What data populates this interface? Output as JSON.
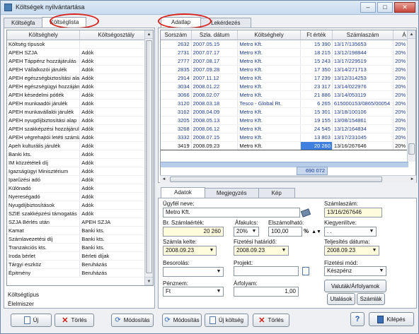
{
  "window": {
    "title": "Költségek nyilvántartása",
    "btn_min": "–",
    "btn_max": "□",
    "btn_close": "✕"
  },
  "left_tabs": [
    {
      "label": "Költségfa"
    },
    {
      "label": "Költséglista"
    }
  ],
  "left_grid": {
    "headers": [
      "Költséghely",
      "Költségosztály"
    ],
    "rows": [
      [
        "Költség típusok",
        ""
      ],
      [
        "APEH SZJA",
        "Adók"
      ],
      [
        "APEH Táppénz hozzájárulás",
        "Adók"
      ],
      [
        "APEH Vállalkozói járulék",
        "Adók"
      ],
      [
        "APEH egészségbiztosítási alap",
        "Adók"
      ],
      [
        "APEH egészségügyi hozzájárulás",
        "Adók"
      ],
      [
        "APEH késedelmi pótlék",
        "Adók"
      ],
      [
        "APEH munkaadói járulék",
        "Adók"
      ],
      [
        "APEH munkavállalói járulék",
        "Adók"
      ],
      [
        "APEH nyugdíjbiztosítási alap",
        "Adók"
      ],
      [
        "APEH szakképzési hozzájárulás",
        "Adók"
      ],
      [
        "APEH végrehajtói letéti számla",
        "Adók"
      ],
      [
        "Apeh kulturális járulék",
        "Adók"
      ],
      [
        "Banki kts.",
        "Adók"
      ],
      [
        "IM közzétételi díj",
        "Adók"
      ],
      [
        "Igazságügyi Minisztérium",
        "Adók"
      ],
      [
        "Iparűzési adó",
        "Adók"
      ],
      [
        "Különadó",
        "Adók"
      ],
      [
        "Nyereségadó",
        "Adók"
      ],
      [
        "Nyugdíjbiztosítások",
        "Adók"
      ],
      [
        "SZIE szakképzési támogatás",
        "Adók"
      ],
      [
        "SZJA Bérlés után",
        "APEH SZJA"
      ],
      [
        "Kamat",
        "Banki kts."
      ],
      [
        "Számlavezetési díj",
        "Banki kts."
      ],
      [
        "Tranzakciós kts.",
        "Banki kts."
      ],
      [
        "Iroda bérlet",
        "Bérleti díjak"
      ],
      [
        "Tárgyi eszköz",
        "Beruházás"
      ],
      [
        "Épitmény",
        "Beruházás"
      ]
    ]
  },
  "left_bottom": {
    "label": "Költségtípus",
    "value": "Élelmiszer"
  },
  "left_buttons": {
    "new": "Új",
    "delete": "Törlés",
    "modify": "Módosítás"
  },
  "right_tabs": [
    {
      "label": "Adatlap"
    },
    {
      "label": "Lekérdezés"
    }
  ],
  "right_grid": {
    "headers": [
      "Sorszám",
      "Szla. dátum",
      "Költséghely",
      "Ft érték",
      "Számlaszám",
      "Á"
    ],
    "rows": [
      [
        "2632",
        "2007.05.15",
        "Metro Kft.",
        "15 390",
        "13/17/135653",
        "20%"
      ],
      [
        "2731",
        "2007.07.17",
        "Metro Kft.",
        "18 215",
        "13/12/198844",
        "20%"
      ],
      [
        "2777",
        "2007.08.17",
        "Metro Kft.",
        "15 243",
        "13/17/229519",
        "20%"
      ],
      [
        "2835",
        "2007.09.28",
        "Metro Kft.",
        "17 350",
        "13/14/271713",
        "20%"
      ],
      [
        "2914",
        "2007.11.12",
        "Metro Kft.",
        "17 239",
        "13/12/314253",
        "20%"
      ],
      [
        "3034",
        "2008.01.22",
        "Metro Kft.",
        "23 317",
        "13/14/022976",
        "20%"
      ],
      [
        "3066",
        "2008.02.07",
        "Metro Kft.",
        "21 886",
        "13/14/053119",
        "20%"
      ],
      [
        "3120",
        "2008.03.18",
        "Tesco - Global Rt.",
        "6 265",
        "615000153/0865/00054",
        "20%"
      ],
      [
        "3162",
        "2008.04.09",
        "Metro Kft.",
        "15 301",
        "13/18/100106",
        "20%"
      ],
      [
        "3205",
        "2008.05.13",
        "Metro Kft.",
        "19 155",
        "13/08/154861",
        "20%"
      ],
      [
        "3268",
        "2008.06.12",
        "Metro Kft.",
        "24 545",
        "13/12/164834",
        "20%"
      ],
      [
        "3332",
        "2008.07.15",
        "Metro Kft.",
        "13 803",
        "13/17/231045",
        "20%"
      ],
      [
        "3419",
        "2008.09.23",
        "Metro Kft.",
        "20 260",
        "13/16/267646",
        "20%"
      ]
    ],
    "selected_index": 12,
    "total": "690 072"
  },
  "detail_tabs": [
    {
      "label": "Adatok"
    },
    {
      "label": "Megjegyzés"
    },
    {
      "label": "Kép"
    }
  ],
  "detail": {
    "ugyfel_label": "Ügyfél neve:",
    "ugyfel_value": "Metro Kft.",
    "szamlaszam_label": "Számlaszám:",
    "szamlaszam_value": "13/16/267646",
    "br_label": "Br. Számlaérték:",
    "br_value": "20 260",
    "afakulcs_label": "Áfakulcs:",
    "afakulcs_value": "20%",
    "elszamolhato_label": "Elszámolható:",
    "elszamolhato_value": "100,00",
    "percent_sign": "%",
    "kiegyenlitve_label": "Kiegyenlítve:",
    "kiegyenlitve_value": ". .",
    "kelte_label": "Számla kelte:",
    "kelte_value": "2008.09.23",
    "hatarido_label": "Fizetési határidő:",
    "hatarido_value": "2008.09.23",
    "teljesites_label": "Teljesítés dátuma:",
    "teljesites_value": "2008.09.23",
    "besorolas_label": "Besorolás:",
    "besorolas_value": "",
    "projekt_label": "Projekt:",
    "projekt_value": "",
    "fizmod_label": "Fizetési mód:",
    "fizmod_value": "Készpénz",
    "penznem_label": "Pénznem:",
    "penznem_value": "Ft",
    "arfolyam_label": "Árfolyam:",
    "arfolyam_value": "1,00"
  },
  "detail_buttons": {
    "valutak": "Valuták/Árfolyamok",
    "utalasok": "Utalások",
    "szamlak": "Számlák"
  },
  "bottom_buttons": {
    "modify": "Módosítás",
    "new_cost": "Új költség",
    "delete": "Törlés",
    "help": "?",
    "exit": "Kilépés"
  },
  "colors": {
    "accent_blue": "#3f7fe0",
    "highlight_red": "#d8211a",
    "yellow_field": "#fffbdc"
  }
}
